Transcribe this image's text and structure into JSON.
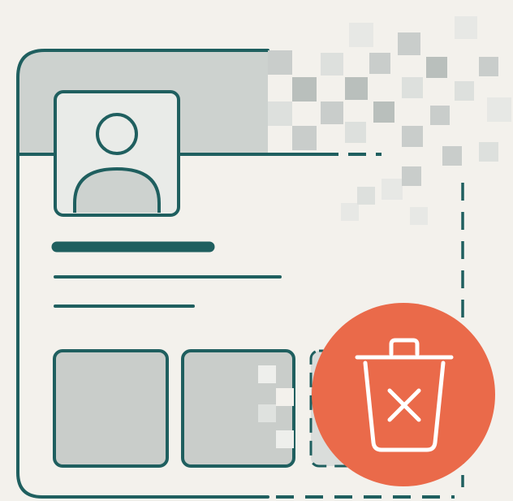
{
  "illustration": {
    "subject": "profile-card-deletion",
    "colors": {
      "background": "#f3f1ec",
      "stroke": "#1f5f5f",
      "header_fill": "#cdd2cf",
      "placeholder_fill": "#c9cdca",
      "pixel_light": "#dde0dd",
      "pixel_mid": "#c9cdcb",
      "pixel_dark": "#b9bfbc",
      "delete_badge": "#ea6a4a",
      "delete_glyph": "#ffffff"
    },
    "icons": {
      "avatar": "user-silhouette-icon",
      "delete": "trash-can-with-x-icon"
    }
  }
}
